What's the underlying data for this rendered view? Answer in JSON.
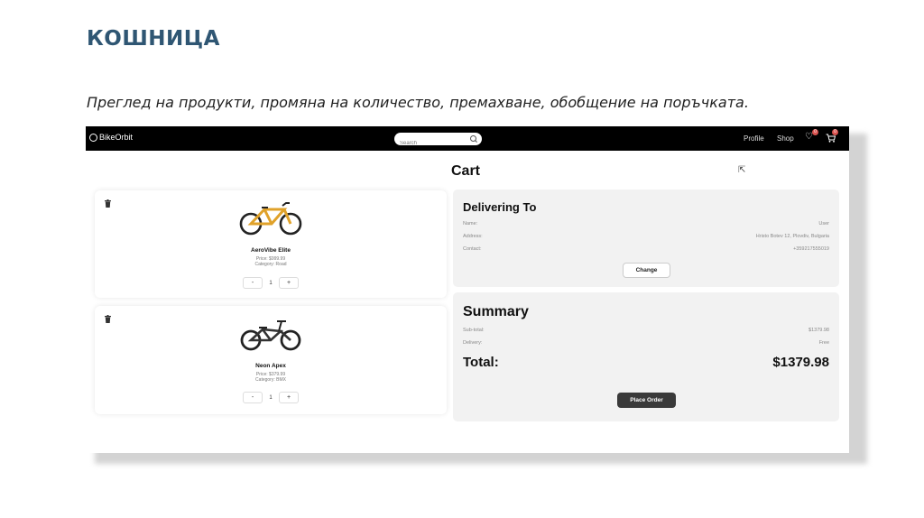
{
  "slide": {
    "title": "КОШНИЦА",
    "subtitle": "Преглед на продукти, промяна на количество, премахване, обобщение на поръчката."
  },
  "navbar": {
    "logo": "BikeOrbit",
    "search_placeholder": "Search",
    "links": {
      "profile": "Profile",
      "shop": "Shop"
    },
    "wishlist_badge": "0",
    "cart_badge": "0"
  },
  "page": {
    "title": "Cart"
  },
  "cart_items": [
    {
      "name": "AeroVibe Elite",
      "price": "Price: $999.99",
      "category": "Category: Road",
      "qty": "1",
      "minus": "-",
      "plus": "+"
    },
    {
      "name": "Neon Apex",
      "price": "Price: $379.99",
      "category": "Category: BMX",
      "qty": "1",
      "minus": "-",
      "plus": "+"
    }
  ],
  "delivery": {
    "title": "Delivering To",
    "rows": [
      {
        "label": "Name:",
        "value": "User"
      },
      {
        "label": "Address:",
        "value": "Hristo Botev 12, Plovdiv, Bulgaria"
      },
      {
        "label": "Contact:",
        "value": "+359217555019"
      }
    ],
    "change_button": "Change"
  },
  "summary": {
    "title": "Summary",
    "subtotal_label": "Sub-total:",
    "subtotal_value": "$1379.98",
    "delivery_label": "Delivery:",
    "delivery_value": "Free",
    "total_label": "Total:",
    "total_value": "$1379.98",
    "place_order_button": "Place Order"
  },
  "colors": {
    "title": "#2f5673",
    "navbar": "#000000",
    "badge": "#d9534f",
    "panel": "#f2f2f2",
    "primary_button": "#3a3a3a"
  }
}
